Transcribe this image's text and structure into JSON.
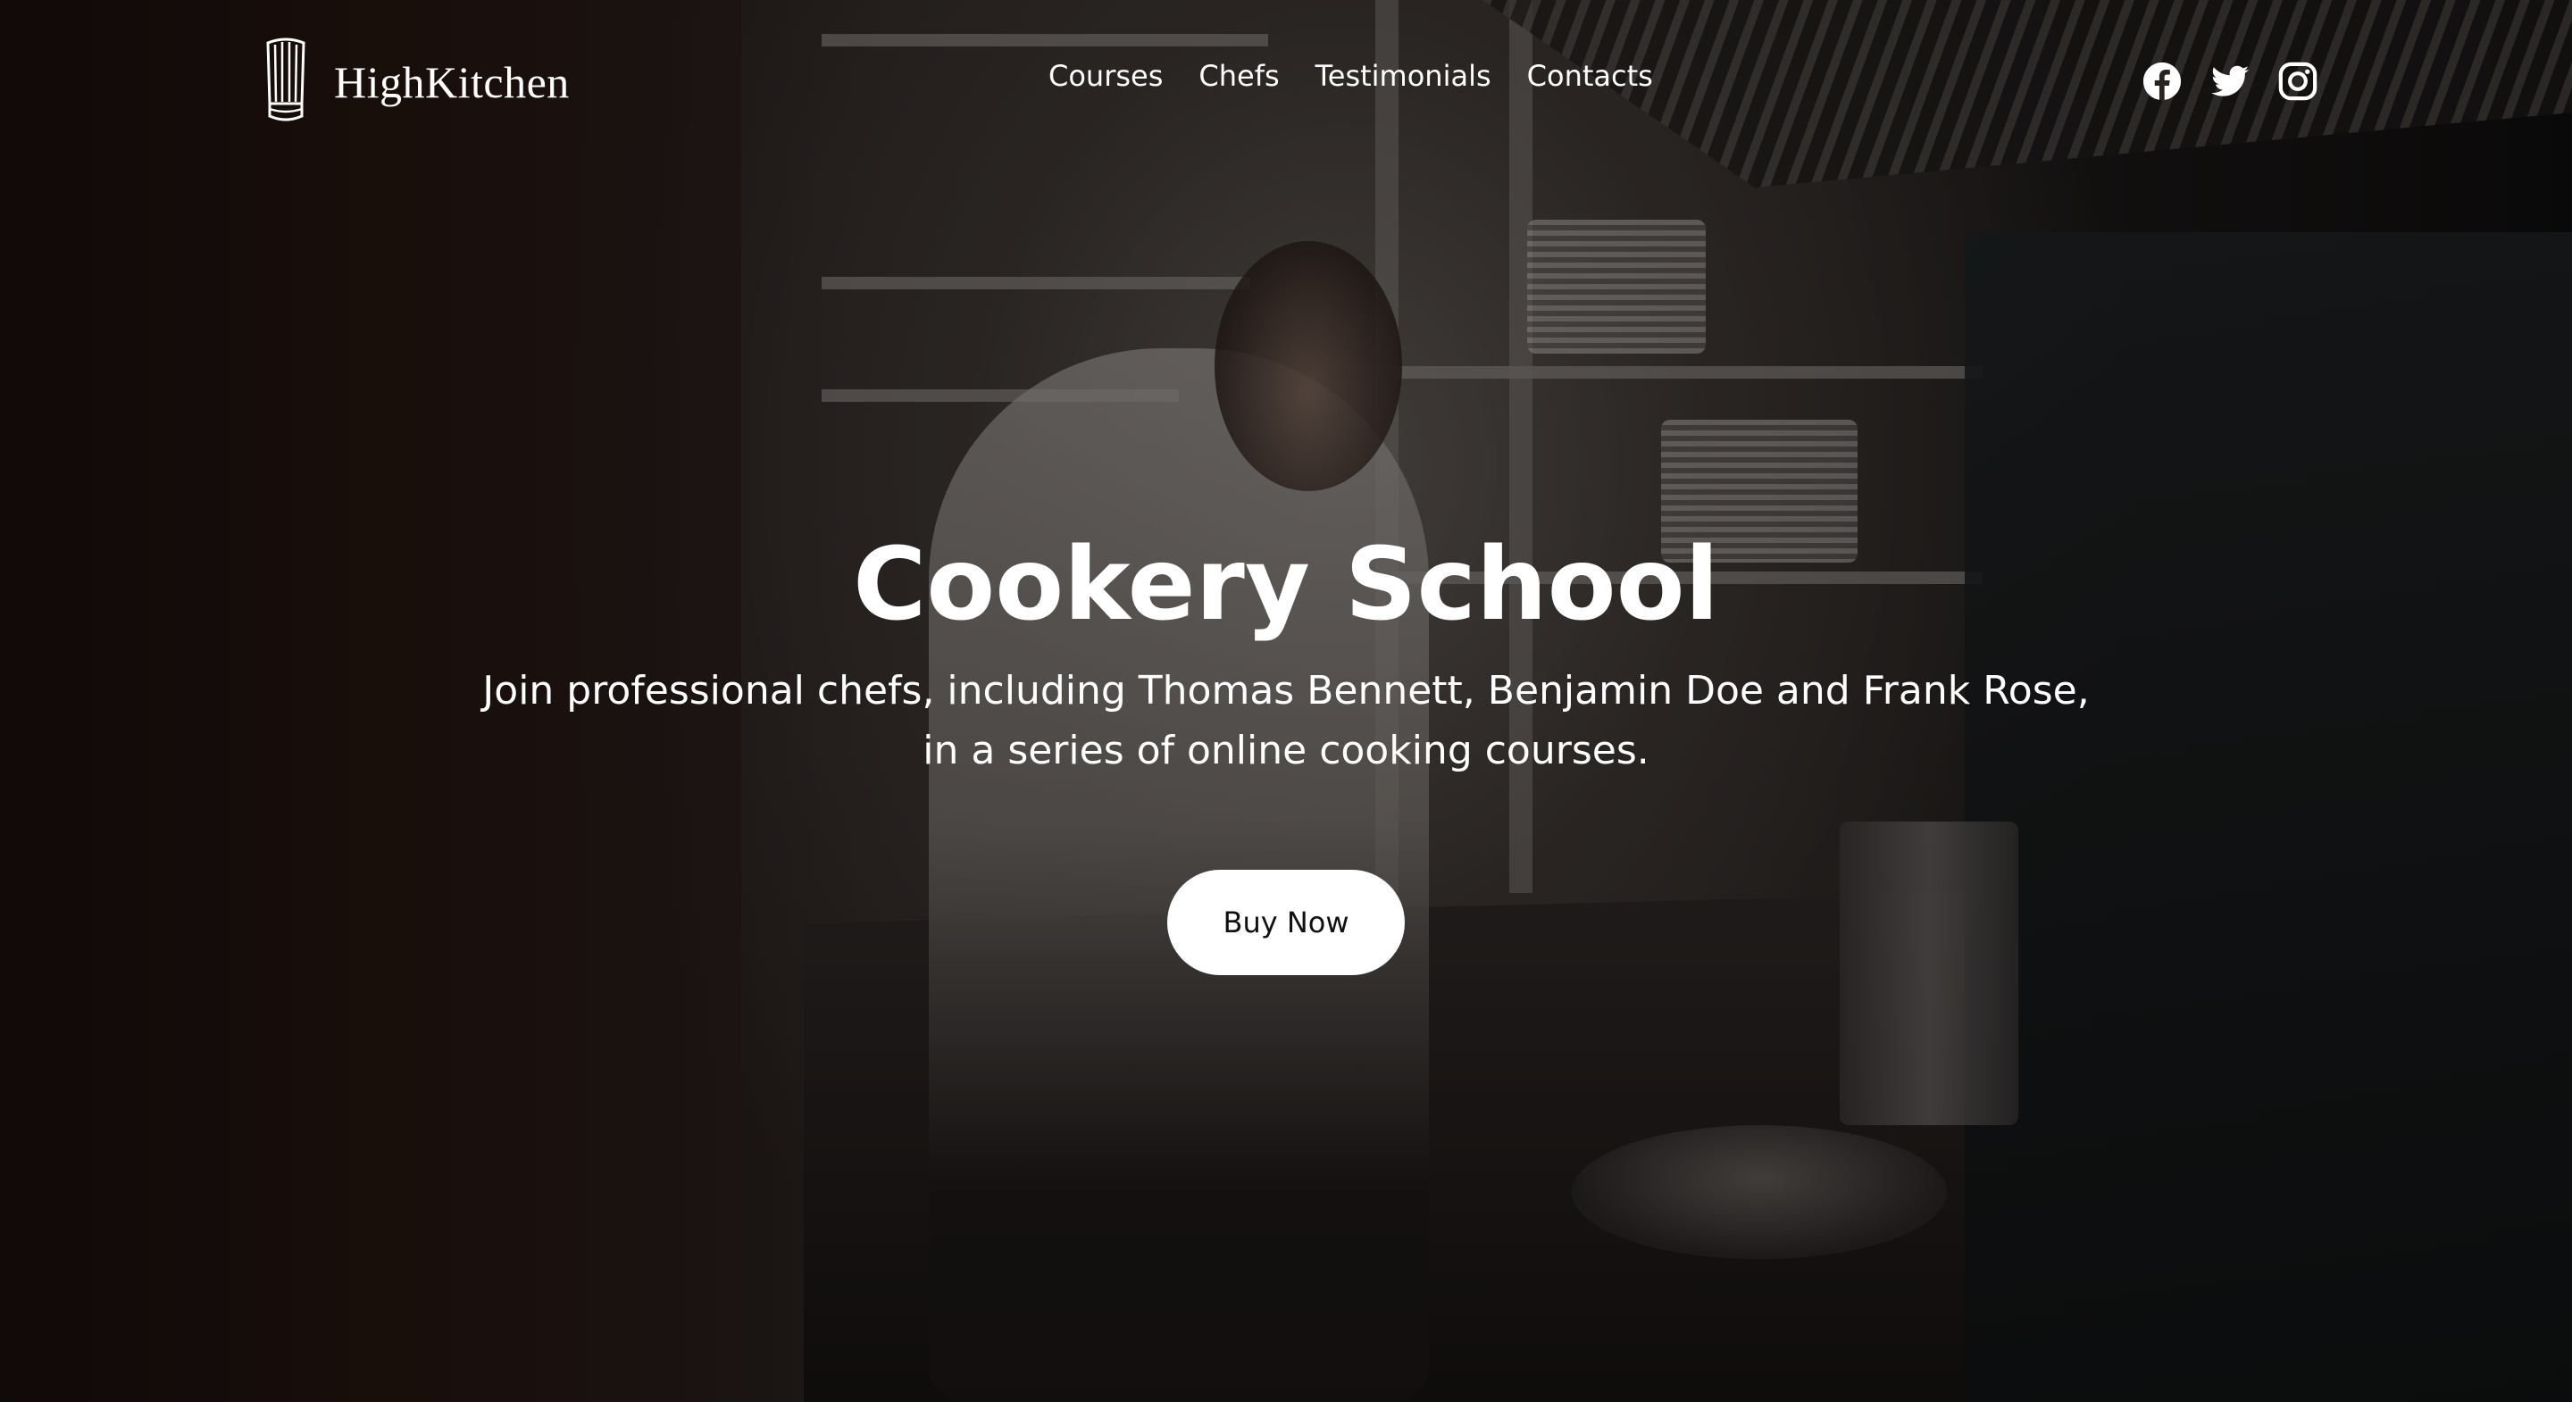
{
  "brand": {
    "name": "HighKitchen",
    "logo_icon": "chef-hat-icon"
  },
  "nav": {
    "links": [
      {
        "label": "Courses"
      },
      {
        "label": "Chefs"
      },
      {
        "label": "Testimonials"
      },
      {
        "label": "Contacts"
      }
    ]
  },
  "social": {
    "icons": [
      "facebook-icon",
      "twitter-icon",
      "instagram-icon"
    ]
  },
  "hero": {
    "title": "Cookery School",
    "subtitle_line1": "Join professional chefs, including Thomas Bennett, Benjamin Doe and Frank Rose,",
    "subtitle_line2": "in a series of online cooking courses.",
    "cta_label": "Buy Now",
    "background_image": "dark-kitchen-chef-photo"
  },
  "colors": {
    "text": "#ffffff",
    "button_bg": "#ffffff",
    "button_text": "#111111"
  }
}
